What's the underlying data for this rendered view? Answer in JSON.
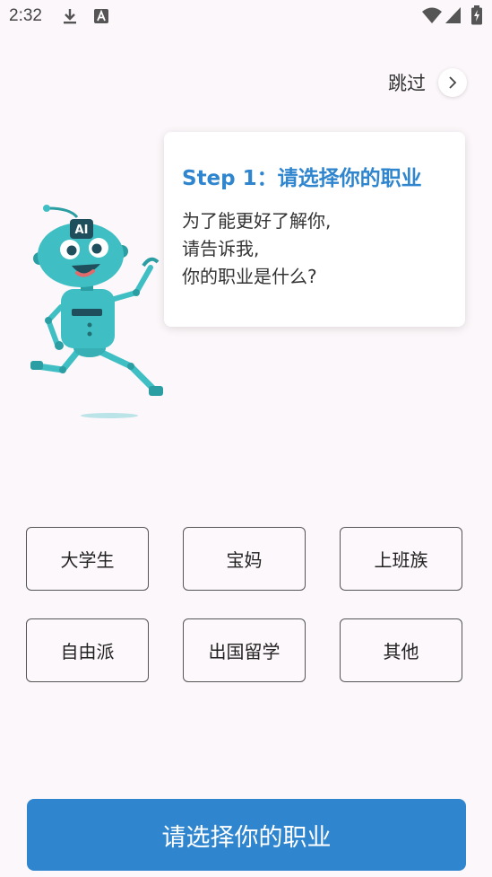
{
  "status_bar": {
    "time": "2:32"
  },
  "skip": {
    "label": "跳过"
  },
  "card": {
    "title": "Step 1：请选择你的职业",
    "lines": [
      "为了能更好了解你,",
      "请告诉我,",
      "你的职业是什么?"
    ]
  },
  "robot": {
    "badge": "AI"
  },
  "options": [
    {
      "label": "大学生"
    },
    {
      "label": "宝妈"
    },
    {
      "label": "上班族"
    },
    {
      "label": "自由派"
    },
    {
      "label": "出国留学"
    },
    {
      "label": "其他"
    }
  ],
  "cta": {
    "label": "请选择你的职业"
  },
  "colors": {
    "accent": "#2f86cf",
    "robot": "#3fbfc4",
    "background": "#fcf7fa"
  }
}
